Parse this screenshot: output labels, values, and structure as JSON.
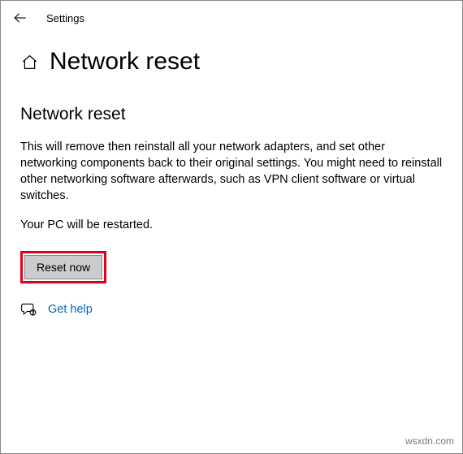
{
  "titlebar": {
    "label": "Settings"
  },
  "page": {
    "title": "Network reset"
  },
  "section": {
    "heading": "Network reset",
    "description": "This will remove then reinstall all your network adapters, and set other networking components back to their original settings. You might need to reinstall other networking software afterwards, such as VPN client software or virtual switches.",
    "restart_note": "Your PC will be restarted."
  },
  "button": {
    "reset_label": "Reset now"
  },
  "help": {
    "label": "Get help"
  },
  "watermark": "wsxdn.com"
}
